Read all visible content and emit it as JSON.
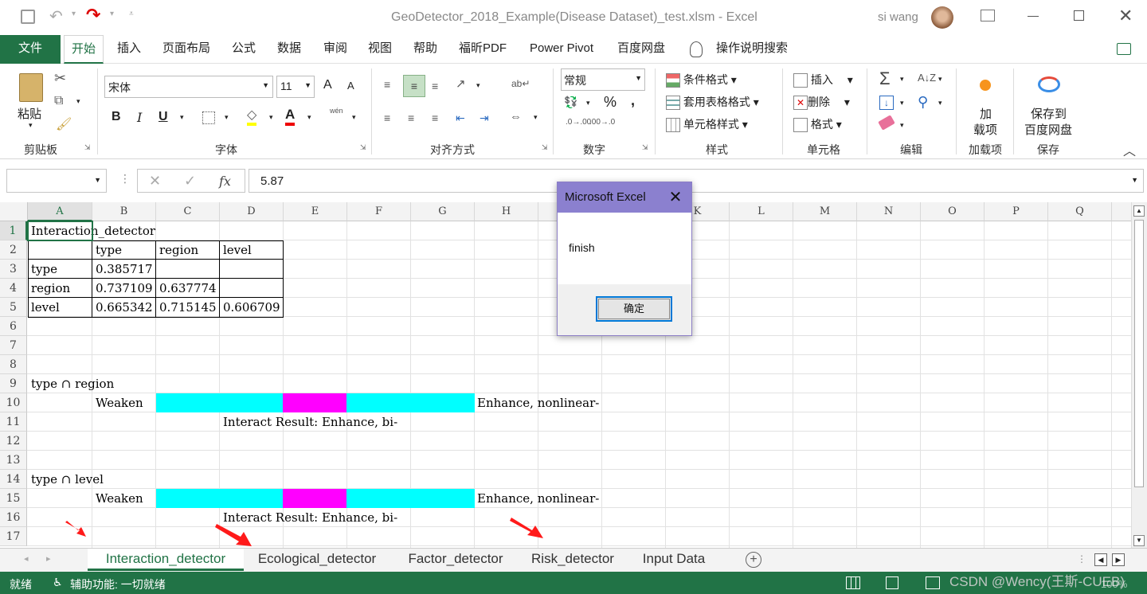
{
  "titlebar": {
    "filename": "GeoDetector_2018_Example(Disease Dataset)_test.xlsm",
    "separator": "-",
    "app": "Excel",
    "user": "si wang"
  },
  "tabs": [
    "文件",
    "开始",
    "插入",
    "页面布局",
    "公式",
    "数据",
    "审阅",
    "视图",
    "帮助",
    "福昕PDF",
    "Power Pivot",
    "百度网盘"
  ],
  "search_label": "操作说明搜索",
  "ribbon": {
    "paste": "粘贴",
    "clipboard": "剪贴板",
    "font_name": "宋体",
    "font_size": "11",
    "font_group": "字体",
    "bold": "B",
    "italic": "I",
    "underline": "U",
    "increase": "A",
    "decrease": "A",
    "wen": "wén",
    "align_group": "对齐方式",
    "number_format": "常规",
    "number_group": "数字",
    "percent": "%",
    "comma": ",",
    "cond_format": "条件格式",
    "table_format": "套用表格格式",
    "cell_style": "单元格样式",
    "style_group": "样式",
    "insert": "插入",
    "delete": "删除",
    "format": "格式",
    "cells_group": "单元格",
    "edit_group": "编辑",
    "addin_top": "加",
    "addin_bottom": "载项",
    "addin_group": "加载项",
    "save_top": "保存到",
    "save_bottom": "百度网盘",
    "save_group": "保存"
  },
  "formula": {
    "name_box": "",
    "fx": "fx",
    "value": "5.87"
  },
  "columns": [
    "A",
    "B",
    "C",
    "D",
    "E",
    "F",
    "G",
    "H",
    "I",
    "J",
    "K",
    "L",
    "M",
    "N",
    "O",
    "P",
    "Q"
  ],
  "rows": [
    "1",
    "2",
    "3",
    "4",
    "5",
    "6",
    "7",
    "8",
    "9",
    "10",
    "11",
    "12",
    "13",
    "14",
    "15",
    "16",
    "17"
  ],
  "cells": {
    "a1": "Interaction_detector",
    "b2": "type",
    "c2": "region",
    "d2": "level",
    "a3": "type",
    "b3": "0.385717",
    "a4": "region",
    "b4": "0.737109",
    "c4": "0.637774",
    "a5": "level",
    "b5": "0.665342",
    "c5": "0.715145",
    "d5": "0.606709",
    "a9": "type ∩ region",
    "b10": "Weaken",
    "h10": "Enhance, nonlinear-",
    "d11": "Interact Result: Enhance, bi-",
    "a14": "type ∩ level",
    "b15": "Weaken",
    "h15": "Enhance, nonlinear-",
    "d16": "Interact Result: Enhance, bi-"
  },
  "colors": {
    "cyan": "#00FFFF",
    "magenta": "#FF00FF",
    "excel_green": "#217346",
    "dialog_title": "#8B80CF"
  },
  "sheets": [
    "Interaction_detector",
    "Ecological_detector",
    "Factor_detector",
    "Risk_detector",
    "Input Data"
  ],
  "status": {
    "ready": "就绪",
    "accessibility": "辅助功能: 一切就绪",
    "zoom": "100%",
    "watermark": "CSDN @Wency(王斯-CUEB)"
  },
  "dialog": {
    "title": "Microsoft Excel",
    "message": "finish",
    "ok": "确定"
  }
}
